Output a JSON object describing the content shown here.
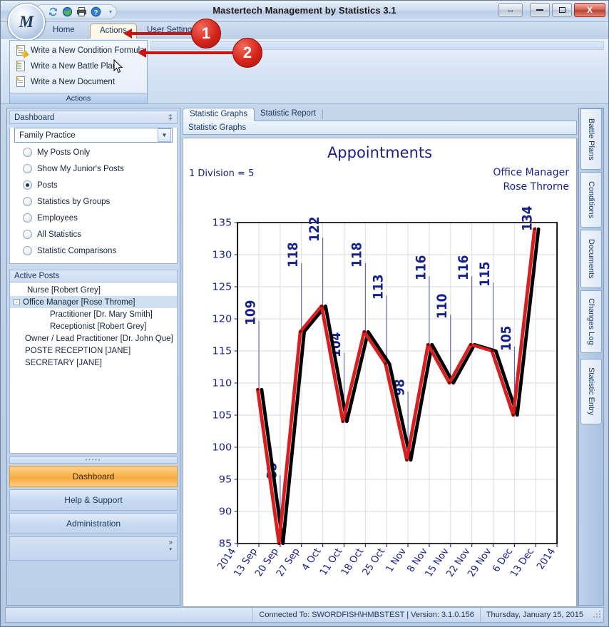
{
  "window": {
    "title": "Mastertech Management by Statistics 3.1",
    "orb_letter": "M",
    "controls": {
      "resize_label": "↔",
      "minimize_label": "",
      "maximize_label": "",
      "close_label": "X"
    },
    "quick_access": [
      {
        "name": "refresh-icon",
        "glyph": "↻"
      },
      {
        "name": "globe-icon",
        "glyph": "●"
      },
      {
        "name": "print-icon",
        "glyph": "⎙"
      },
      {
        "name": "help-icon",
        "glyph": "?"
      }
    ],
    "qat_chevron": "▾"
  },
  "ribbon": {
    "tabs": [
      {
        "label": "Home",
        "selected": false
      },
      {
        "label": "Actions",
        "selected": true
      },
      {
        "label": "User Settings",
        "selected": false
      }
    ],
    "group": {
      "title": "Actions",
      "items": [
        {
          "label": "Write a New Condition Formula",
          "icon": "condition-formula-icon"
        },
        {
          "label": "Write a New Battle Plan",
          "icon": "battle-plan-icon"
        },
        {
          "label": "Write a New Document",
          "icon": "document-icon"
        }
      ]
    }
  },
  "callouts": [
    {
      "number": "1"
    },
    {
      "number": "2"
    }
  ],
  "sidebar": {
    "dashboard": {
      "title": "Dashboard",
      "pin_glyph": "‡",
      "combo": {
        "value": "Family Practice",
        "arrow": "▼"
      },
      "options": [
        {
          "label": "My Posts Only",
          "selected": false
        },
        {
          "label": "Show My Junior's Posts",
          "selected": false
        },
        {
          "label": "Posts",
          "selected": true
        },
        {
          "label": "Statistics by Groups",
          "selected": false
        },
        {
          "label": "Employees",
          "selected": false
        },
        {
          "label": "All Statistics",
          "selected": false
        },
        {
          "label": "Statistic Comparisons",
          "selected": false
        }
      ]
    },
    "active_posts": {
      "title": "Active Posts",
      "rows": [
        {
          "label": "Nurse [Robert Grey]",
          "indent": 1,
          "expander": "",
          "selected": false
        },
        {
          "label": "Office Manager [Rose Throme]",
          "indent": 0,
          "expander": "-",
          "selected": true
        },
        {
          "label": "Practitioner  [Dr. Mary Smith]",
          "indent": 2,
          "expander": "",
          "selected": false
        },
        {
          "label": "Receptionist  [Robert Grey]",
          "indent": 2,
          "expander": "",
          "selected": false
        },
        {
          "label": "Owner / Lead Practitioner  [Dr. John Que]",
          "indent": 1,
          "expander": "",
          "selected": false
        },
        {
          "label": "POSTE RECEPTION [JANE]",
          "indent": 1,
          "expander": "",
          "selected": false
        },
        {
          "label": "SECRETARY [JANE]",
          "indent": 1,
          "expander": "",
          "selected": false
        }
      ]
    },
    "nav_buttons": [
      {
        "label": "Dashboard",
        "active": true
      },
      {
        "label": "Help & Support",
        "active": false
      },
      {
        "label": "Administration",
        "active": false
      }
    ],
    "overflow_glyph": "»"
  },
  "content": {
    "tabs": [
      {
        "label": "Statistic Graphs",
        "selected": true
      },
      {
        "label": "Statistic Report",
        "selected": false
      }
    ],
    "subheader": "Statistic Graphs"
  },
  "right_tabs": [
    {
      "label": "Battle Plans"
    },
    {
      "label": "Conditions"
    },
    {
      "label": "Documents"
    },
    {
      "label": "Changes Log"
    },
    {
      "label": "Statistic Entry"
    }
  ],
  "status": {
    "connection": "Connected To: SWORDFISH\\HMBSTEST | Version: 3.1.0.156",
    "date": "Thursday, January 15, 2015"
  },
  "chart_data": {
    "type": "line",
    "title": "Appointments",
    "subtitle": "1 Division = 5",
    "annotation_right": "Office Manager\nRose Throrne",
    "annotation_right_line1": "Office Manager",
    "annotation_right_line2": "Rose Throrne",
    "xlabel": "",
    "ylabel": "",
    "ylim": [
      85,
      135
    ],
    "ytick_step": 5,
    "yticks": [
      85,
      90,
      95,
      100,
      105,
      110,
      115,
      120,
      125,
      130,
      135
    ],
    "grid": true,
    "legend": "none",
    "categories": [
      "2014",
      "13 Sep",
      "20 Sep",
      "27 Sep",
      "4 Oct",
      "11 Oct",
      "18 Oct",
      "25 Oct",
      "1 Nov",
      "8 Nov",
      "15 Nov",
      "22 Nov",
      "29 Nov",
      "6 Dec",
      "13 Dec",
      "2014"
    ],
    "point_labels": [
      "109",
      "85",
      "118",
      "122",
      "104",
      "118",
      "113",
      "98",
      "116",
      "110",
      "116",
      "115",
      "105",
      "134"
    ],
    "series": [
      {
        "name": "value-line",
        "color": "#d81f1f",
        "x": [
          "13 Sep",
          "20 Sep",
          "27 Sep",
          "4 Oct",
          "11 Oct",
          "18 Oct",
          "25 Oct",
          "1 Nov",
          "8 Nov",
          "15 Nov",
          "22 Nov",
          "29 Nov",
          "6 Dec",
          "13 Dec"
        ],
        "values": [
          109,
          85,
          118,
          122,
          104,
          118,
          113,
          98,
          116,
          110,
          116,
          115,
          105,
          134
        ]
      },
      {
        "name": "trend-line",
        "color": "#000000",
        "x": [
          "13 Sep",
          "20 Sep",
          "27 Sep",
          "4 Oct",
          "11 Oct",
          "18 Oct",
          "25 Oct",
          "1 Nov",
          "8 Nov",
          "15 Nov",
          "22 Nov",
          "29 Nov",
          "6 Dec",
          "13 Dec"
        ],
        "values": [
          109,
          85,
          118,
          122,
          104,
          118,
          113,
          98,
          116,
          110,
          116,
          115,
          105,
          134
        ]
      }
    ]
  }
}
